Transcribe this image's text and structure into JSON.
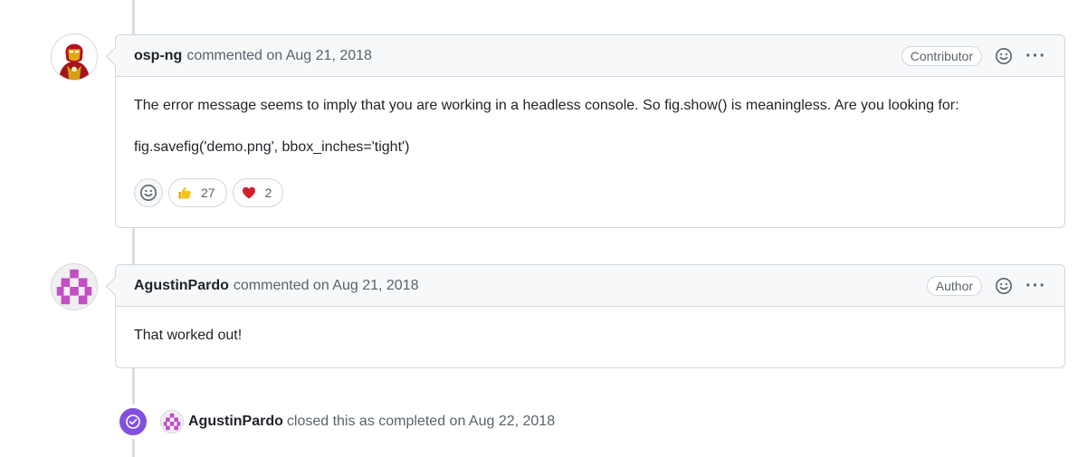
{
  "comments": [
    {
      "author": "osp-ng",
      "meta": "commented on Aug 21, 2018",
      "role": "Contributor",
      "body": [
        "The error message seems to imply that you are working in a headless console. So fig.show() is meaningless. Are you looking for:",
        "fig.savefig('demo.png', bbox_inches='tight')"
      ],
      "reactions": [
        {
          "emoji": "👍",
          "count": "27"
        },
        {
          "emoji": "❤",
          "count": "2"
        }
      ]
    },
    {
      "author": "AgustinPardo",
      "meta": "commented on Aug 21, 2018",
      "role": "Author",
      "body": [
        "That worked out!"
      ]
    }
  ],
  "event": {
    "actor": "AgustinPardo",
    "text": "closed this as completed on Aug 22, 2018"
  },
  "icons": {
    "reaction_add": "smiley-icon",
    "options": "kebab-horizontal-icon",
    "closed": "check-circle-icon"
  },
  "colors": {
    "closed_badge": "#8250df",
    "identicon": "#c44ec6",
    "heart": "#cf222e"
  }
}
